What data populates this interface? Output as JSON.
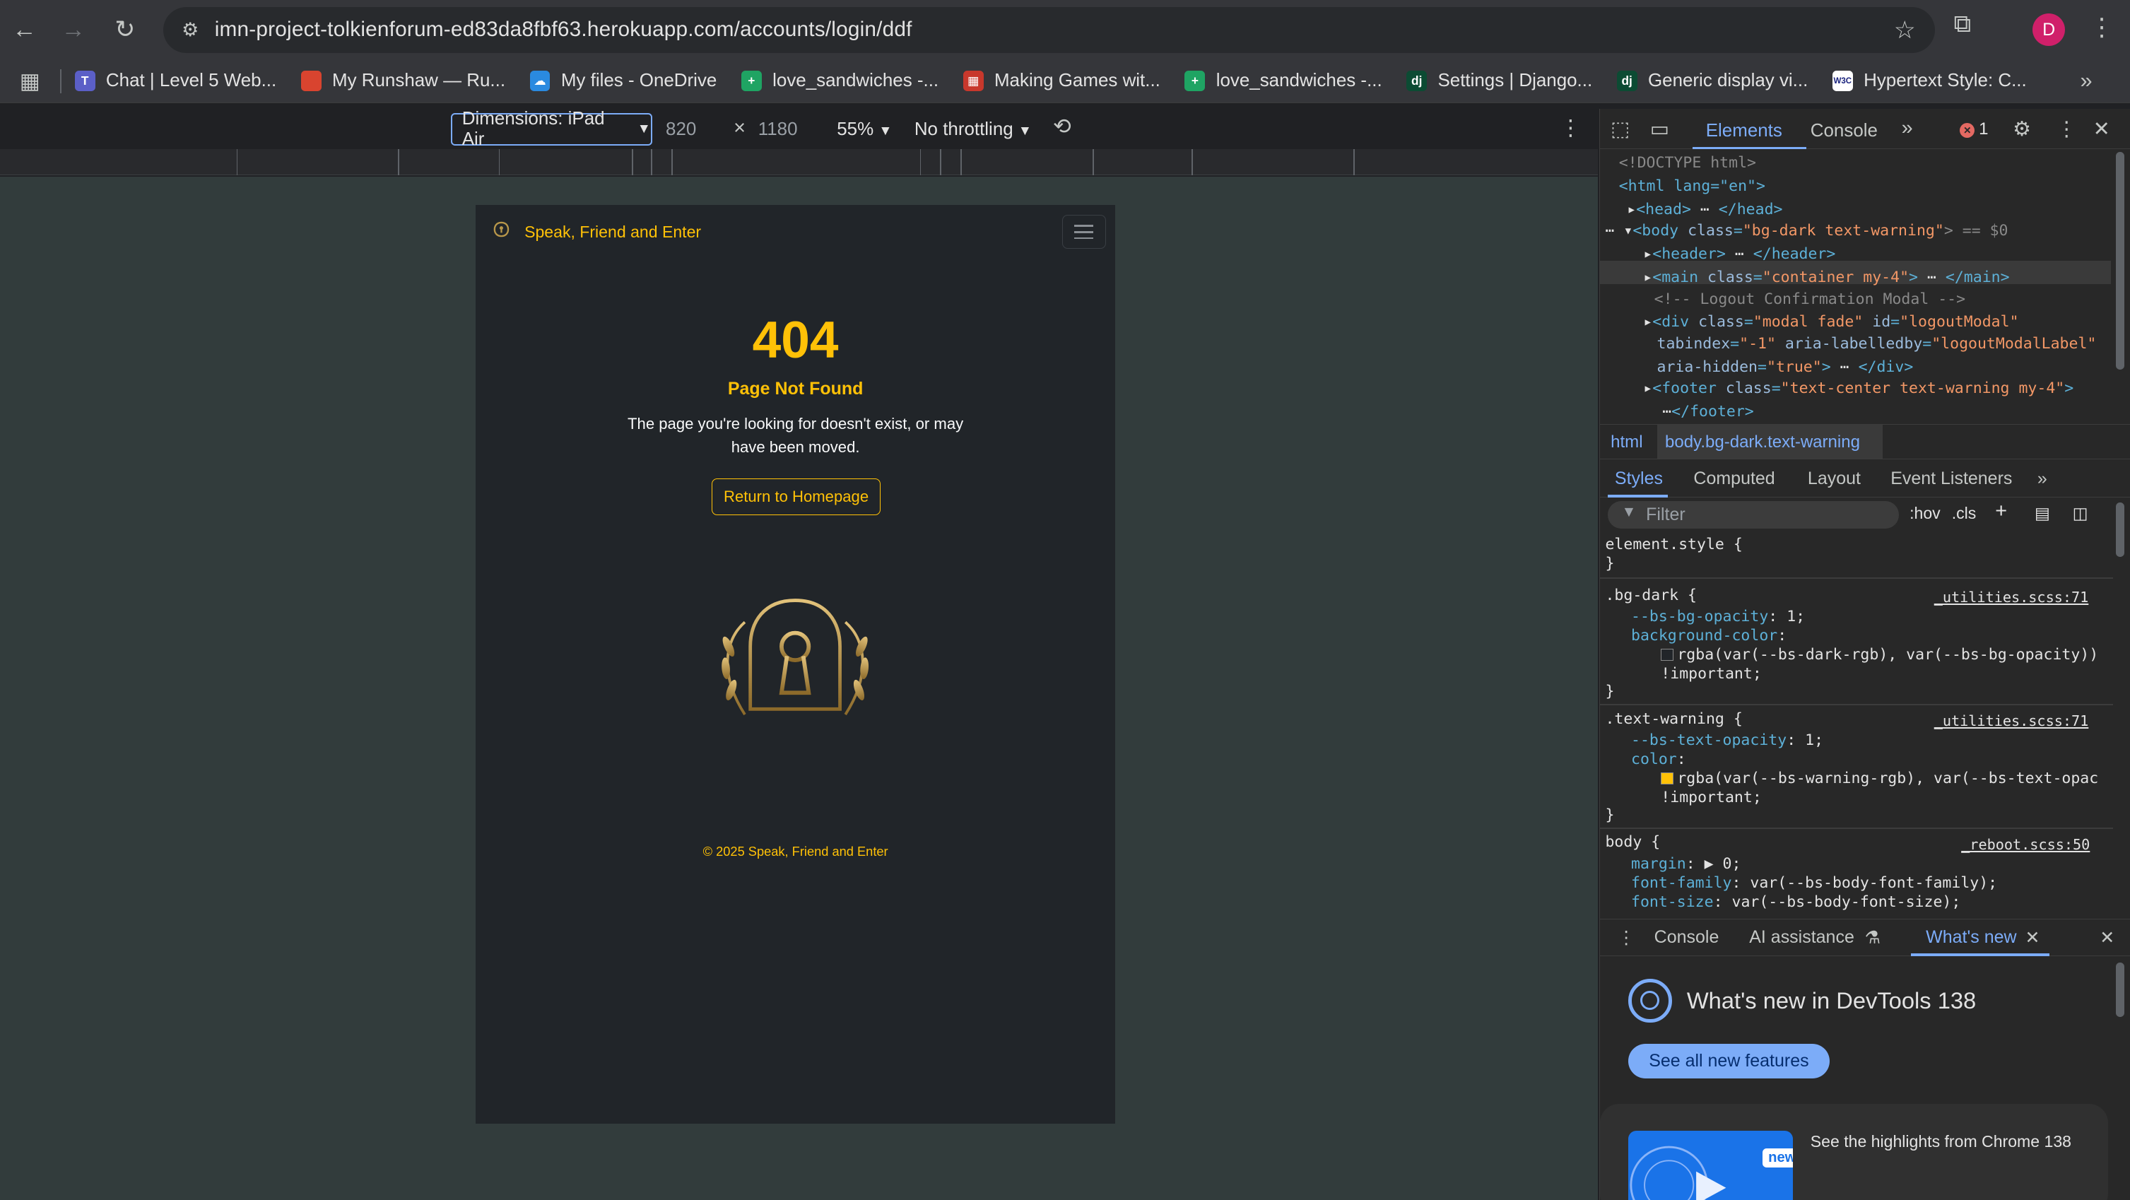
{
  "browser": {
    "url": "imn-project-tolkienforum-ed83da8fbf63.herokuapp.com/accounts/login/ddf",
    "avatar_letter": "D",
    "bookmarks": [
      {
        "label": "Chat | Level 5 Web...",
        "icon_color": "#5b5fc7",
        "icon": "T"
      },
      {
        "label": "My Runshaw — Ru...",
        "icon_color": "#d9442f",
        "icon": ""
      },
      {
        "label": "My files - OneDrive",
        "icon_color": "#2a8ae0",
        "icon": "☁"
      },
      {
        "label": "love_sandwiches -...",
        "icon_color": "#1fa463",
        "icon": "+"
      },
      {
        "label": "Making Games wit...",
        "icon_color": "#c8382c",
        "icon": "▦"
      },
      {
        "label": "love_sandwiches -...",
        "icon_color": "#1fa463",
        "icon": "+"
      },
      {
        "label": "Settings | Django...",
        "icon_color": "#0c4b33",
        "icon": "dj"
      },
      {
        "label": "Generic display vi...",
        "icon_color": "#0c4b33",
        "icon": "dj"
      },
      {
        "label": "Hypertext Style: C...",
        "icon_color": "#ffffff",
        "icon": "W3C"
      }
    ]
  },
  "device_toolbar": {
    "dimensions": "Dimensions: iPad Air",
    "width": "820",
    "times": "×",
    "height": "1180",
    "zoom": "55%",
    "throttling": "No throttling"
  },
  "page": {
    "brand": "Speak, Friend and Enter",
    "error_code": "404",
    "error_title": "Page Not Found",
    "error_message": "The page you're looking for doesn't exist, or may have been moved.",
    "home_button": "Return to Homepage",
    "footer": "© 2025 Speak, Friend and Enter",
    "colors": {
      "background": "#212529",
      "accent": "#ffc107"
    }
  },
  "devtools": {
    "tabs": {
      "elements": "Elements",
      "console": "Console"
    },
    "error_count": "1",
    "dom_lines": {
      "doctype": "<!DOCTYPE html>",
      "html_open": "<html lang=\"en\">",
      "head": "<head>",
      "head_close": "</head>",
      "body_tag": "<body",
      "body_class_attr": "class",
      "body_class_val": "\"bg-dark text-warning\"",
      "body_suffix": "> == $0",
      "header": "<header>",
      "header_close": "</header>",
      "main_tag": "<main",
      "main_class_attr": "class",
      "main_class_val": "\"container my-4\"",
      "main_close": "</main>",
      "comment": "<!-- Logout Confirmation Modal -->",
      "div_tag": "<div",
      "div_class_attr": "class",
      "div_class_val": "\"modal fade\"",
      "div_id_attr": "id",
      "div_id_val": "\"logoutModal\"",
      "tabindex_attr": "tabindex",
      "tabindex_val": "\"-1\"",
      "aria_lab_attr": "aria-labelledby",
      "aria_lab_val": "\"logoutModalLabel\"",
      "aria_hidden_attr": "aria-hidden",
      "aria_hidden_val": "\"true\"",
      "div_close": "</div>",
      "footer_tag": "<footer",
      "footer_class_attr": "class",
      "footer_class_val": "\"text-center text-warning my-4\"",
      "footer_close": "</footer>"
    },
    "breadcrumbs": [
      "html",
      "body.bg-dark.text-warning"
    ],
    "style_tabs": [
      "Styles",
      "Computed",
      "Layout",
      "Event Listeners"
    ],
    "filter_placeholder": "Filter",
    "filter_hov": ":hov",
    "filter_cls": ".cls",
    "styles": {
      "element_style": "element.style {",
      "close": "}",
      "bg_dark_sel": ".bg-dark {",
      "bg_dark_src": "_utilities.scss:71",
      "bg_opacity_prop": "--bs-bg-opacity",
      "bg_opacity_val": ": 1;",
      "bg_color_prop": "background-color",
      "bg_color_colon": ":",
      "bg_color_val": "rgba(var(--bs-dark-rgb), var(--bs-bg-opacity))",
      "important": "!important;",
      "tw_sel": ".text-warning {",
      "tw_src": "_utilities.scss:71",
      "tw_opacity_prop": "--bs-text-opacity",
      "tw_opacity_val": ": 1;",
      "tw_color_prop": "color",
      "tw_color_colon": ":",
      "tw_color_val": "rgba(var(--bs-warning-rgb), var(--bs-text-opac",
      "body_sel": "body {",
      "body_src": "_reboot.scss:50",
      "margin_prop": "margin",
      "margin_val": ": ▶ 0;",
      "ff_prop": "font-family",
      "ff_val": ": var(--bs-body-font-family);",
      "fs_prop": "font-size",
      "fs_val": ": var(--bs-body-font-size);"
    },
    "drawer": {
      "tabs": [
        "Console",
        "AI assistance",
        "What's new"
      ],
      "whats_new_title": "What's new in DevTools 138",
      "see_all": "See all new features",
      "card_badge": "new",
      "card_text": "See the highlights from Chrome 138"
    }
  }
}
